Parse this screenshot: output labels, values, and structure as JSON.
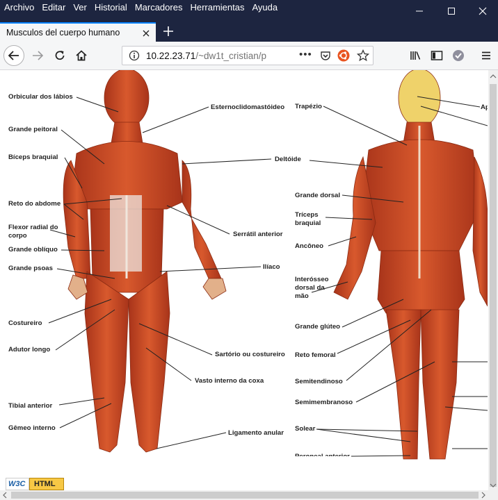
{
  "menu": [
    "Archivo",
    "Editar",
    "Ver",
    "Historial",
    "Marcadores",
    "Herramientas",
    "Ayuda"
  ],
  "tab": {
    "title": "Musculos del cuerpo humano"
  },
  "url": {
    "host": "10.22.23.71",
    "path": "/~dw1t_cristian/p"
  },
  "labels": {
    "left": [
      "Orbicular dos lábios",
      "Grande peitoral",
      "Bíceps braquial",
      "Reto do abdome",
      "Flexor radial do",
      "corpo",
      "Grande oblíquo",
      "Grande psoas",
      "Costureiro",
      "Adutor longo",
      "Tibial anterior",
      "Gêmeo interno"
    ],
    "center": [
      "Esternoclidomastóideo",
      "Deltóide",
      "Serrátil anterior",
      "Ilíaco",
      "Sartório ou costureiro",
      "Vasto interno da coxa",
      "Ligamento anular"
    ],
    "right": [
      "Trapézio",
      "Grande dorsal",
      "Tríceps",
      "braquial",
      "Ancôneo",
      "Interósseo",
      "dorsal da",
      "mão",
      "Grande glúteo",
      "Reto femoral",
      "Semitendinoso",
      "Semimembranoso",
      "Solear",
      "Peroneal anterior"
    ],
    "edge": "Ap"
  },
  "badge": {
    "text": "HTML",
    "logo": "W3C"
  },
  "colors": {
    "chrome": "#1d2540",
    "accent": "#0a84ff",
    "muscle": "#c8441f",
    "ubuntu": "#e95420"
  }
}
